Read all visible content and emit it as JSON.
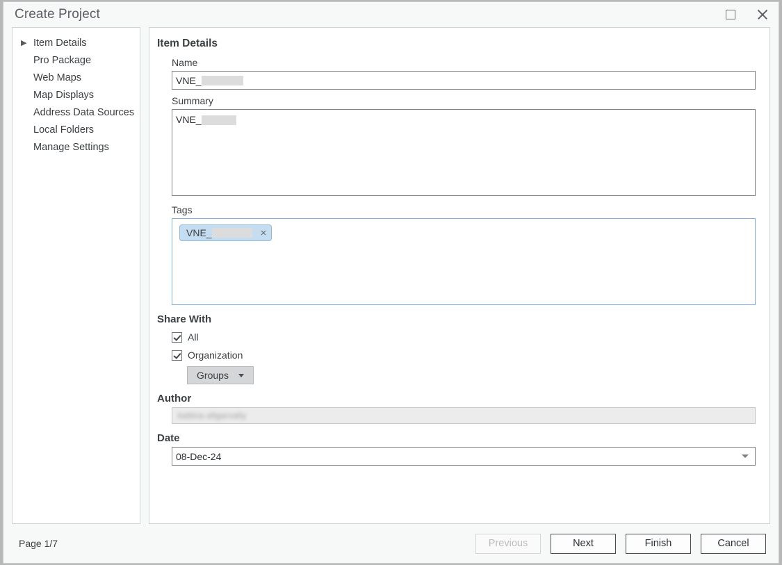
{
  "window": {
    "title": "Create Project",
    "maximize_icon": "maximize-icon",
    "close_icon": "close-icon"
  },
  "sidebar": {
    "items": [
      {
        "label": "Item Details",
        "selected": true,
        "arrow": "▶"
      },
      {
        "label": "Pro Package",
        "selected": false,
        "arrow": ""
      },
      {
        "label": "Web Maps",
        "selected": false,
        "arrow": ""
      },
      {
        "label": "Map Displays",
        "selected": false,
        "arrow": ""
      },
      {
        "label": "Address Data Sources",
        "selected": false,
        "arrow": ""
      },
      {
        "label": "Local Folders",
        "selected": false,
        "arrow": ""
      },
      {
        "label": "Manage Settings",
        "selected": false,
        "arrow": ""
      }
    ]
  },
  "content": {
    "heading": "Item Details",
    "name": {
      "label": "Name",
      "value": "VNE_",
      "redacted": true
    },
    "summary": {
      "label": "Summary",
      "value": "VNE_",
      "redacted": true
    },
    "tags": {
      "label": "Tags",
      "chips": [
        {
          "text": "VNE_",
          "redacted": true,
          "remove_icon": "×"
        }
      ]
    },
    "share_with": {
      "label": "Share With",
      "all": {
        "label": "All",
        "checked": true
      },
      "organization": {
        "label": "Organization",
        "checked": true
      },
      "groups_button": {
        "label": "Groups",
        "icon": "chevron-down-icon"
      }
    },
    "author": {
      "label": "Author",
      "value": "kattina afigarvally",
      "redacted": true,
      "disabled": true
    },
    "date": {
      "label": "Date",
      "value": "08-Dec-24",
      "icon": "chevron-down-icon"
    }
  },
  "footer": {
    "page_indicator": "Page 1/7",
    "buttons": [
      {
        "label": "Previous",
        "disabled": true
      },
      {
        "label": "Next",
        "disabled": false
      },
      {
        "label": "Finish",
        "disabled": false
      },
      {
        "label": "Cancel",
        "disabled": false
      }
    ]
  },
  "colors": {
    "tag_chip_bg": "#c5ddf1",
    "tag_box_border": "#7eaede",
    "dialog_bg": "#f7f8f8",
    "panel_bg": "#ffffff",
    "text": "#3c4043"
  }
}
